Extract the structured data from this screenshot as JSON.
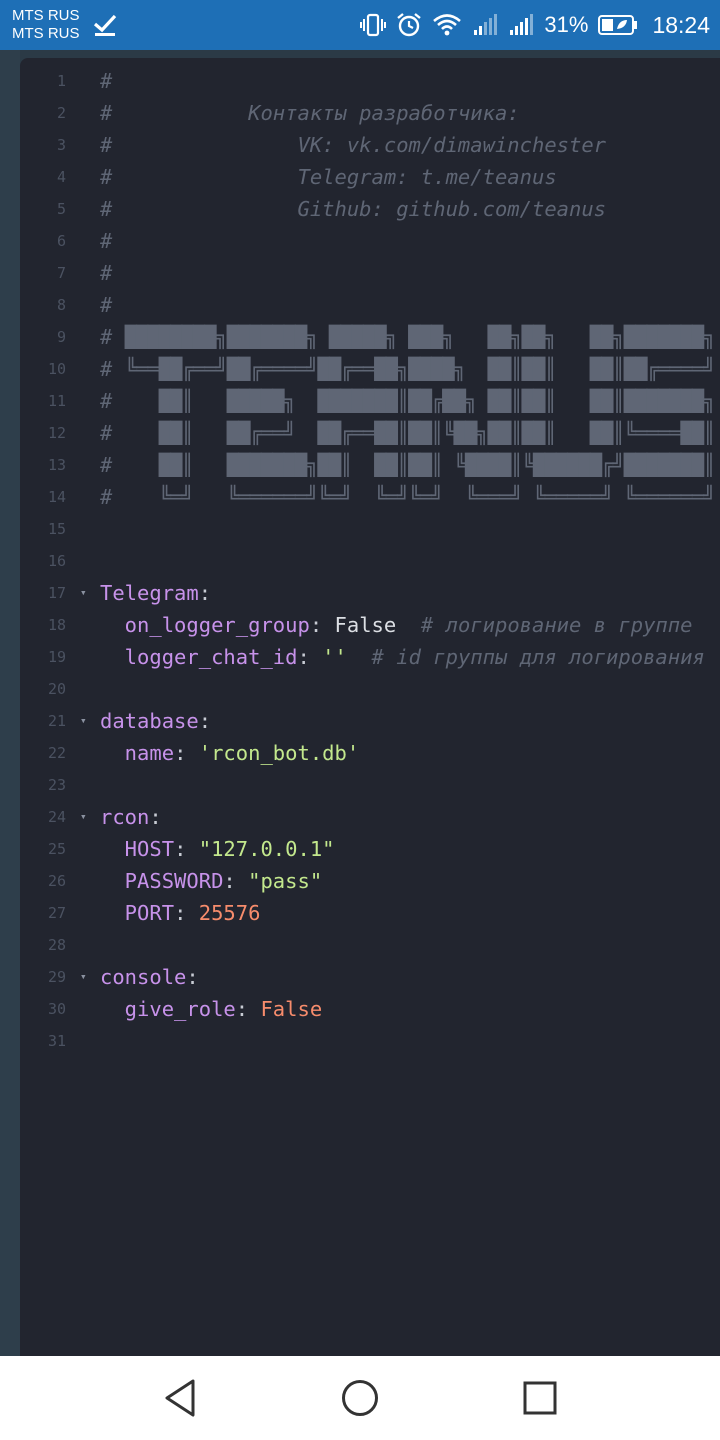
{
  "status_bar": {
    "carrier_1": "MTS RUS",
    "carrier_2": "MTS RUS",
    "battery_percent": "31%",
    "time": "18:24",
    "background_color": "#1e6fb6"
  },
  "editor": {
    "background_color": "#22252f",
    "lines": [
      {
        "num": "1",
        "fold": "",
        "tokens": [
          {
            "t": "#",
            "c": "c"
          }
        ]
      },
      {
        "num": "2",
        "fold": "",
        "tokens": [
          {
            "t": "#           Контакты разработчика:",
            "c": "c"
          }
        ]
      },
      {
        "num": "3",
        "fold": "",
        "tokens": [
          {
            "t": "#               VK: vk.com/dimawinchester",
            "c": "c"
          }
        ]
      },
      {
        "num": "4",
        "fold": "",
        "tokens": [
          {
            "t": "#               Telegram: t.me/teanus",
            "c": "c"
          }
        ]
      },
      {
        "num": "5",
        "fold": "",
        "tokens": [
          {
            "t": "#               Github: github.com/teanus",
            "c": "c"
          }
        ]
      },
      {
        "num": "6",
        "fold": "",
        "tokens": [
          {
            "t": "#",
            "c": "c"
          }
        ]
      },
      {
        "num": "7",
        "fold": "",
        "tokens": [
          {
            "t": "#",
            "c": "c"
          }
        ]
      },
      {
        "num": "8",
        "fold": "",
        "tokens": [
          {
            "t": "#",
            "c": "c"
          }
        ]
      },
      {
        "num": "9",
        "fold": "",
        "tokens": [
          {
            "t": "# ",
            "c": "c"
          },
          {
            "t": "████████╗███████╗ █████╗ ███╗   ██╗██╗   ██╗███████╗",
            "c": "art"
          }
        ]
      },
      {
        "num": "10",
        "fold": "",
        "tokens": [
          {
            "t": "# ",
            "c": "c"
          },
          {
            "t": "╚══██╔══╝██╔════╝██╔══██╗████╗  ██║██║   ██║██╔════╝",
            "c": "art"
          }
        ]
      },
      {
        "num": "11",
        "fold": "",
        "tokens": [
          {
            "t": "# ",
            "c": "c"
          },
          {
            "t": "   ██║   █████╗  ███████║██╔██╗ ██║██║   ██║███████╗",
            "c": "art"
          }
        ]
      },
      {
        "num": "12",
        "fold": "",
        "tokens": [
          {
            "t": "# ",
            "c": "c"
          },
          {
            "t": "   ██║   ██╔══╝  ██╔══██║██║╚██╗██║██║   ██║╚════██║",
            "c": "art"
          }
        ]
      },
      {
        "num": "13",
        "fold": "",
        "tokens": [
          {
            "t": "# ",
            "c": "c"
          },
          {
            "t": "   ██║   ███████╗██║  ██║██║ ╚████║╚██████╔╝███████║",
            "c": "art"
          }
        ]
      },
      {
        "num": "14",
        "fold": "",
        "tokens": [
          {
            "t": "# ",
            "c": "c"
          },
          {
            "t": "   ╚═╝   ╚══════╝╚═╝  ╚═╝╚═╝  ╚═══╝ ╚═════╝ ╚══════╝",
            "c": "art"
          }
        ]
      },
      {
        "num": "15",
        "fold": "",
        "tokens": []
      },
      {
        "num": "16",
        "fold": "",
        "tokens": []
      },
      {
        "num": "17",
        "fold": "▾",
        "tokens": [
          {
            "t": "Telegram",
            "c": "k"
          },
          {
            "t": ":",
            "c": "p"
          }
        ]
      },
      {
        "num": "18",
        "fold": "",
        "tokens": [
          {
            "t": "  on_logger_group",
            "c": "k"
          },
          {
            "t": ": ",
            "c": "p"
          },
          {
            "t": "False",
            "c": "b"
          },
          {
            "t": "  # логирование в группе",
            "c": "c"
          }
        ]
      },
      {
        "num": "19",
        "fold": "",
        "tokens": [
          {
            "t": "  logger_chat_id",
            "c": "k"
          },
          {
            "t": ": ",
            "c": "p"
          },
          {
            "t": "''",
            "c": "s"
          },
          {
            "t": "  # id группы для логирования",
            "c": "c"
          }
        ]
      },
      {
        "num": "20",
        "fold": "",
        "tokens": []
      },
      {
        "num": "21",
        "fold": "▾",
        "tokens": [
          {
            "t": "database",
            "c": "k"
          },
          {
            "t": ":",
            "c": "p"
          }
        ]
      },
      {
        "num": "22",
        "fold": "",
        "tokens": [
          {
            "t": "  name",
            "c": "k"
          },
          {
            "t": ": ",
            "c": "p"
          },
          {
            "t": "'rcon_bot.db'",
            "c": "s"
          }
        ]
      },
      {
        "num": "23",
        "fold": "",
        "tokens": []
      },
      {
        "num": "24",
        "fold": "▾",
        "tokens": [
          {
            "t": "rcon",
            "c": "k"
          },
          {
            "t": ":",
            "c": "p"
          }
        ]
      },
      {
        "num": "25",
        "fold": "",
        "tokens": [
          {
            "t": "  HOST",
            "c": "k"
          },
          {
            "t": ": ",
            "c": "p"
          },
          {
            "t": "\"127.0.0.1\"",
            "c": "s"
          }
        ]
      },
      {
        "num": "26",
        "fold": "",
        "tokens": [
          {
            "t": "  PASSWORD",
            "c": "k"
          },
          {
            "t": ": ",
            "c": "p"
          },
          {
            "t": "\"pass\"",
            "c": "s"
          }
        ]
      },
      {
        "num": "27",
        "fold": "",
        "tokens": [
          {
            "t": "  PORT",
            "c": "k"
          },
          {
            "t": ": ",
            "c": "p"
          },
          {
            "t": "25576",
            "c": "n"
          }
        ]
      },
      {
        "num": "28",
        "fold": "",
        "tokens": []
      },
      {
        "num": "29",
        "fold": "▾",
        "tokens": [
          {
            "t": "console",
            "c": "k"
          },
          {
            "t": ":",
            "c": "p"
          }
        ]
      },
      {
        "num": "30",
        "fold": "",
        "tokens": [
          {
            "t": "  give_role",
            "c": "k"
          },
          {
            "t": ": ",
            "c": "p"
          },
          {
            "t": "False",
            "c": "n"
          }
        ]
      },
      {
        "num": "31",
        "fold": "",
        "tokens": []
      }
    ]
  },
  "token_colors": {
    "comment": "#5f6675",
    "key": "#c792ea",
    "string": "#c3e88d",
    "number_bool": "#f78c6c",
    "plain": "#c8ccd4"
  },
  "icons": [
    "check-icon",
    "vibrate-icon",
    "alarm-icon",
    "wifi-icon",
    "signal-icon",
    "battery-icon",
    "back-icon",
    "home-icon",
    "recents-icon"
  ]
}
